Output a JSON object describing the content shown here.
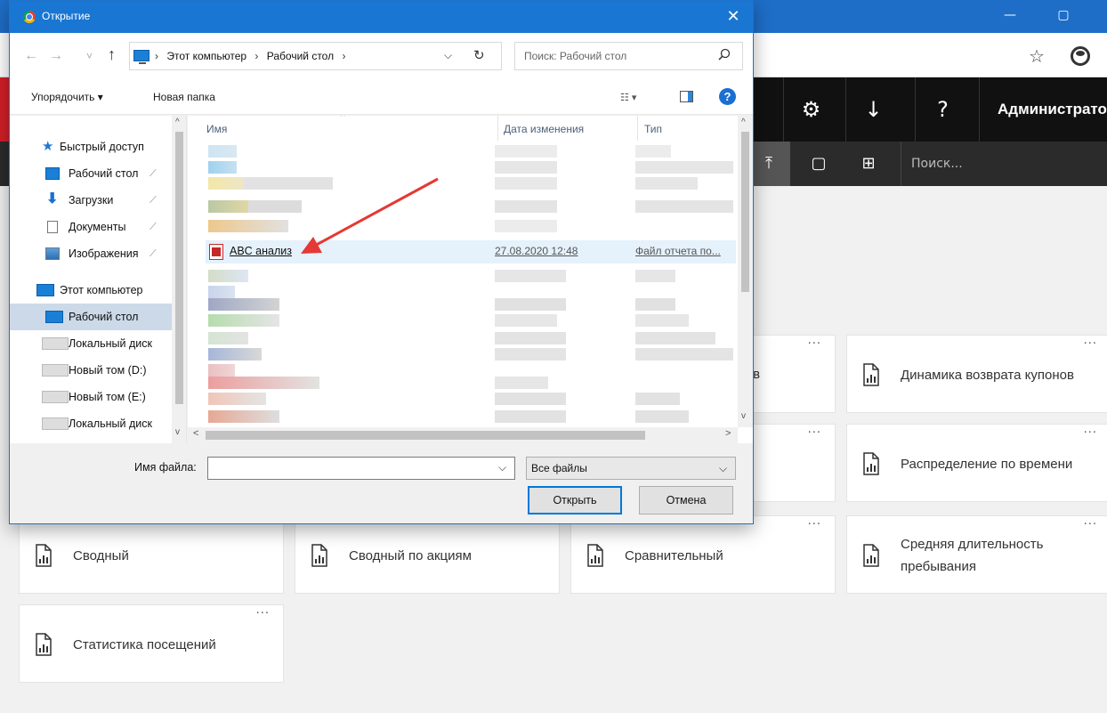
{
  "browser": {
    "restore_icon": "▢",
    "minimize_icon": "—",
    "star_icon": "☆"
  },
  "app": {
    "header": {
      "settings_icon": "⚙",
      "download_icon": "↓",
      "help_icon": "?",
      "user": "Администратор"
    },
    "toolbar": {
      "upload_icon": "⤒",
      "new_icon": "▢",
      "grid_icon": "⊞",
      "search_placeholder": "Поиск..."
    },
    "tiles": [
      {
        "label": "Динамика возврата купонов"
      },
      {
        "label": "Распределение по времени"
      },
      {
        "label": "Сводный"
      },
      {
        "label": "Сводный по акциям"
      },
      {
        "label": "Сравнительный"
      },
      {
        "label": "Средняя длительность пребывания"
      },
      {
        "label": "Статистика посещений"
      }
    ],
    "partial_tile_text": "в",
    "more_icon": "···"
  },
  "dialog": {
    "title": "Открытие",
    "close_icon": "✕",
    "nav": {
      "back_icon": "←",
      "forward_icon": "→",
      "recent_icon": "˅",
      "up_icon": "↑",
      "path": [
        "Этот компьютер",
        "Рабочий стол"
      ],
      "sep": "›",
      "refresh_icon": "↻",
      "search_placeholder": "Поиск: Рабочий стол",
      "search_icon": "⚲"
    },
    "commands": {
      "organize": "Упорядочить ▾",
      "new_folder": "Новая папка",
      "view_icon": "☷ ▾",
      "help_icon": "?"
    },
    "sidebar": [
      {
        "label": "Быстрый доступ",
        "icon": "star-icon",
        "pinned": false
      },
      {
        "label": "Рабочий стол",
        "icon": "desktop-icon",
        "pinned": true
      },
      {
        "label": "Загрузки",
        "icon": "download-icon",
        "pinned": true
      },
      {
        "label": "Документы",
        "icon": "document-icon",
        "pinned": true
      },
      {
        "label": "Изображения",
        "icon": "image-icon",
        "pinned": true
      },
      {
        "label": "Этот компьютер",
        "icon": "computer-icon",
        "pinned": false
      },
      {
        "label": "Рабочий стол",
        "icon": "desktop-icon",
        "pinned": false,
        "selected": true
      },
      {
        "label": "Локальный диск",
        "icon": "disk-icon",
        "pinned": false
      },
      {
        "label": "Новый том (D:)",
        "icon": "disk-icon",
        "pinned": false
      },
      {
        "label": "Новый том (E:)",
        "icon": "disk-icon",
        "pinned": false
      },
      {
        "label": "Локальный диск",
        "icon": "disk-icon",
        "pinned": false
      }
    ],
    "pin_icon": "📌",
    "columns": {
      "name": "Имя",
      "date": "Дата изменения",
      "type": "Тип"
    },
    "highlighted_file": {
      "name": "ABC анализ",
      "date": "27.08.2020 12:48",
      "type": "Файл отчета по..."
    },
    "filename_label": "Имя файла:",
    "filename_value": "",
    "filter": "Все файлы",
    "open_button": "Открыть",
    "cancel_button": "Отмена",
    "dropdown_icon": "⌵"
  }
}
